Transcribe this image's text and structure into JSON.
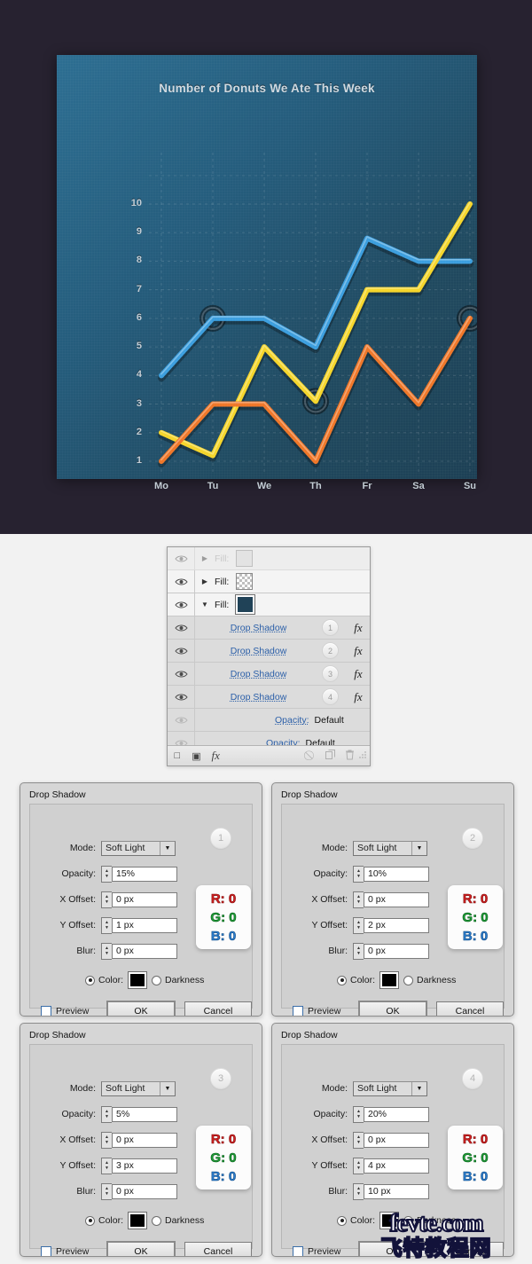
{
  "chart_data": {
    "type": "line",
    "title": "Number of Donuts We Ate This Week",
    "xlabel": "",
    "ylabel": "",
    "categories": [
      "Mo",
      "Tu",
      "We",
      "Th",
      "Fr",
      "Sa",
      "Su"
    ],
    "ylim": [
      0,
      10.5
    ],
    "yticks": [
      "1",
      "2",
      "3",
      "4",
      "5",
      "6",
      "7",
      "8",
      "9",
      "10"
    ],
    "grid": true,
    "legend": "none",
    "series": [
      {
        "name": "blue",
        "color": "#3b9ede",
        "values": [
          4,
          6,
          6,
          5,
          8.8,
          8,
          8
        ]
      },
      {
        "name": "yellow",
        "color": "#f5d52a",
        "values": [
          2,
          1.2,
          5,
          3.1,
          7,
          7,
          10
        ]
      },
      {
        "name": "orange",
        "color": "#ef7628",
        "values": [
          1,
          3,
          3,
          1,
          5,
          3,
          6
        ]
      }
    ],
    "markers": [
      {
        "series": "blue",
        "category": "Tu",
        "value": 6
      },
      {
        "series": "yellow",
        "category": "Th",
        "value": 3.1
      },
      {
        "series": "orange",
        "category": "Su",
        "value": 6
      }
    ],
    "background": "#255d7d",
    "page_background": "#272230",
    "label_color": "#c3cdd5"
  },
  "layers_panel": {
    "rows": [
      {
        "kind": "fill",
        "label": "Fill:",
        "swatch": "plain",
        "triangle": "▶",
        "faded": true
      },
      {
        "kind": "fill",
        "label": "Fill:",
        "swatch": "checker",
        "triangle": "▶",
        "faded": false
      },
      {
        "kind": "fill",
        "label": "Fill:",
        "swatch": "navy",
        "triangle": "▼",
        "faded": false
      },
      {
        "kind": "effect",
        "label": "Drop Shadow",
        "number": "1",
        "fx": "fx"
      },
      {
        "kind": "effect",
        "label": "Drop Shadow",
        "number": "2",
        "fx": "fx"
      },
      {
        "kind": "effect",
        "label": "Drop Shadow",
        "number": "3",
        "fx": "fx"
      },
      {
        "kind": "effect",
        "label": "Drop Shadow",
        "number": "4",
        "fx": "fx"
      },
      {
        "kind": "opacity",
        "key": "Opacity:",
        "value": "Default",
        "indent": 1
      },
      {
        "kind": "opacity",
        "key": "Opacity:",
        "value": "Default",
        "indent": 2
      }
    ],
    "toolbar": [
      {
        "name": "link-layers-icon",
        "glyph": "□",
        "dim": false
      },
      {
        "name": "layer-mask-icon",
        "glyph": "▣",
        "dim": false
      },
      {
        "name": "layer-style-fx-icon",
        "glyph": "fx",
        "dim": false
      },
      {
        "name": "adjustment-layer-icon",
        "glyph": "⃠",
        "dim": true
      },
      {
        "name": "new-layer-icon",
        "glyph": "❐",
        "dim": true
      },
      {
        "name": "delete-layer-icon",
        "glyph": "Ὕ1",
        "dim": true
      }
    ]
  },
  "dialogs": [
    {
      "title": "Drop Shadow",
      "step": "1",
      "mode_label": "Mode:",
      "mode_value": "Soft Light",
      "opacity_label": "Opacity:",
      "opacity_value": "15%",
      "xoffset_label": "X Offset:",
      "xoffset_value": "0 px",
      "yoffset_label": "Y Offset:",
      "yoffset_value": "1 px",
      "blur_label": "Blur:",
      "blur_value": "0 px",
      "color_label": "Color:",
      "darkness_label": "Darkness",
      "preview_label": "Preview",
      "ok_label": "OK",
      "cancel_label": "Cancel",
      "rgb": {
        "r": "R: 0",
        "g": "G: 0",
        "b": "B: 0"
      }
    },
    {
      "title": "Drop Shadow",
      "step": "2",
      "mode_label": "Mode:",
      "mode_value": "Soft Light",
      "opacity_label": "Opacity:",
      "opacity_value": "10%",
      "xoffset_label": "X Offset:",
      "xoffset_value": "0 px",
      "yoffset_label": "Y Offset:",
      "yoffset_value": "2 px",
      "blur_label": "Blur:",
      "blur_value": "0 px",
      "color_label": "Color:",
      "darkness_label": "Darkness",
      "preview_label": "Preview",
      "ok_label": "OK",
      "cancel_label": "Cancel",
      "rgb": {
        "r": "R: 0",
        "g": "G: 0",
        "b": "B: 0"
      }
    },
    {
      "title": "Drop Shadow",
      "step": "3",
      "mode_label": "Mode:",
      "mode_value": "Soft Light",
      "opacity_label": "Opacity:",
      "opacity_value": "5%",
      "xoffset_label": "X Offset:",
      "xoffset_value": "0 px",
      "yoffset_label": "Y Offset:",
      "yoffset_value": "3 px",
      "blur_label": "Blur:",
      "blur_value": "0 px",
      "color_label": "Color:",
      "darkness_label": "Darkness",
      "preview_label": "Preview",
      "ok_label": "OK",
      "cancel_label": "Cancel",
      "rgb": {
        "r": "R: 0",
        "g": "G: 0",
        "b": "B: 0"
      }
    },
    {
      "title": "Drop Shadow",
      "step": "4",
      "mode_label": "Mode:",
      "mode_value": "Soft Light",
      "opacity_label": "Opacity:",
      "opacity_value": "20%",
      "xoffset_label": "X Offset:",
      "xoffset_value": "0 px",
      "yoffset_label": "Y Offset:",
      "yoffset_value": "4 px",
      "blur_label": "Blur:",
      "blur_value": "10 px",
      "color_label": "Color:",
      "darkness_label": "Darkness",
      "preview_label": "Preview",
      "ok_label": "OK",
      "cancel_label": "Cancel",
      "rgb": {
        "r": "R: 0",
        "g": "G: 0",
        "b": "B: 0"
      }
    }
  ],
  "watermark": {
    "english": "fevte.com",
    "chinese": "飞特教程网"
  }
}
